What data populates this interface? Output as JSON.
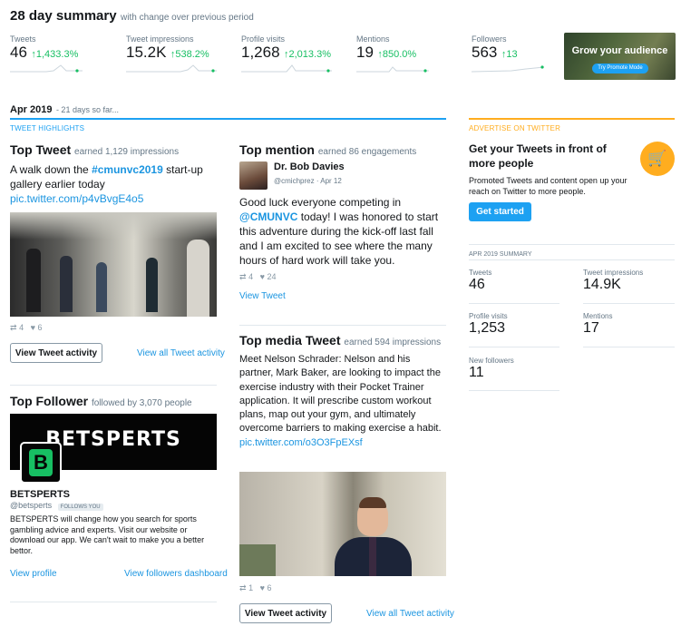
{
  "header": {
    "title": "28 day summary",
    "subtitle": "with change over previous period"
  },
  "stats": [
    {
      "label": "Tweets",
      "value": "46",
      "change": "1,433.3%"
    },
    {
      "label": "Tweet impressions",
      "value": "15.2K",
      "change": "538.2%"
    },
    {
      "label": "Profile visits",
      "value": "1,268",
      "change": "2,013.3%"
    },
    {
      "label": "Mentions",
      "value": "19",
      "change": "850.0%"
    },
    {
      "label": "Followers",
      "value": "563",
      "change": "13"
    }
  ],
  "promo_banner": {
    "text": "Grow your audience",
    "button": "Try Promote Mode"
  },
  "period": {
    "title": "Apr 2019",
    "subtitle": "- 21 days so far..."
  },
  "highlights": {
    "section_label": "TWEET HIGHLIGHTS",
    "top_tweet": {
      "title": "Top Tweet",
      "sub": "earned 1,129 impressions",
      "text_before": "A walk down the ",
      "hashtag": "#cmunvc2019",
      "text_after": " start-up gallery earlier today",
      "link": "pic.twitter.com/p4vBvgE4o5",
      "retweets": "4",
      "likes": "6",
      "activity_button": "View Tweet activity",
      "all_activity_link": "View all Tweet activity"
    },
    "top_follower": {
      "title": "Top Follower",
      "sub": "followed by 3,070 people",
      "banner_text": "BETSPERTS",
      "name": "BETSPERTS",
      "handle": "@betsperts",
      "follows_badge": "FOLLOWS YOU",
      "bio": "BETSPERTS will change how you search for sports gambling advice and experts. Visit our website or download our app. We can't wait to make you a better bettor.",
      "view_profile": "View profile",
      "view_dashboard": "View followers dashboard"
    },
    "top_mention": {
      "title": "Top mention",
      "sub": "earned 86 engagements",
      "author": "Dr. Bob Davies",
      "handle": "@cmichprez",
      "date": "· Apr 12",
      "text_before": "Good luck everyone competing in ",
      "mention": "@CMUNVC",
      "text_after": " today! I was honored to start this adventure during the kick-off last fall and I am excited to see where the many hours of hard work will take you.",
      "retweets": "4",
      "likes": "24",
      "view_tweet": "View Tweet"
    },
    "top_media": {
      "title": "Top media Tweet",
      "sub": "earned 594 impressions",
      "text": "Meet Nelson Schrader: Nelson and his partner, Mark Baker, are looking to impact the exercise industry with their Pocket Trainer application. It will prescribe custom workout plans, map out your gym, and ultimately overcome barriers to making exercise a habit.",
      "link": "pic.twitter.com/o3O3FpEXsf",
      "retweets": "1",
      "likes": "6",
      "activity_button": "View Tweet activity",
      "all_activity_link": "View all Tweet activity"
    }
  },
  "advertise": {
    "section_label": "ADVERTISE ON TWITTER",
    "title": "Get your Tweets in front of more people",
    "body": "Promoted Tweets and content open up your reach on Twitter to more people.",
    "button": "Get started"
  },
  "summary": {
    "section_label": "APR 2019 SUMMARY",
    "items": [
      {
        "label": "Tweets",
        "value": "46"
      },
      {
        "label": "Tweet impressions",
        "value": "14.9K"
      },
      {
        "label": "Profile visits",
        "value": "1,253"
      },
      {
        "label": "Mentions",
        "value": "17"
      },
      {
        "label": "New followers",
        "value": "11"
      }
    ]
  },
  "colors": {
    "accent": "#1da1f2",
    "up": "#17bf63",
    "advertise": "#ffad1f",
    "link": "#1b95e0"
  }
}
